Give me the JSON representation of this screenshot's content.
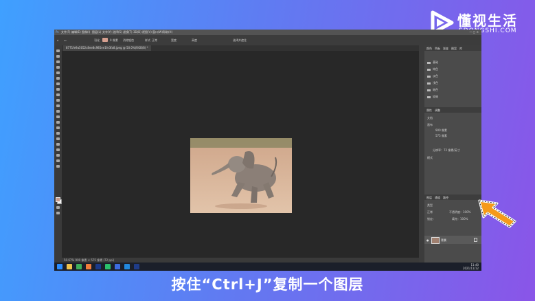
{
  "brand": {
    "name_cn": "懂视生活",
    "name_en": "SDONGSHI.COM"
  },
  "menu": [
    "文件(F)",
    "编辑(E)",
    "图像(I)",
    "图层(L)",
    "文字(Y)",
    "选择(S)",
    "滤镜(T)",
    "3D(D)",
    "视图(V)",
    "窗口(W)",
    "帮助(H)"
  ],
  "options_bar": {
    "feather_label": "羽化",
    "feather_value": "0 像素",
    "antialias": "消除锯齿",
    "style_label": "样式",
    "style_value": "正常",
    "width_label": "宽度",
    "height_label": "高度",
    "select_mask": "选择并遮住"
  },
  "document_tab": "8771fe9a5052c8ee8c985ee1fe3fa8.jpeg @ 50.0%(RGB/8) *",
  "status": "50.67%   900 像素 × 575 像素 (72 ppi)",
  "panels": {
    "top_tabs": [
      "颜色",
      "色板",
      "渐变",
      "图案",
      "库"
    ],
    "swatch_groups": [
      "基础",
      "纯色",
      "淡色",
      "浅色",
      "暗色",
      "较暗"
    ],
    "properties_tabs": [
      "属性",
      "调整"
    ],
    "properties_doc": "文档",
    "canvas_label": "画布",
    "width_value": "900 像素",
    "height_value": "575 像素",
    "resolution": "分辨率：72 像素/英寸",
    "mode": "模式",
    "layers_tabs": [
      "图层",
      "通道",
      "路径"
    ],
    "layer_kind": "类型",
    "blend_mode": "正常",
    "opacity": "不透明度：100%",
    "lock_label": "锁定：",
    "fill": "填充：100%",
    "layer_name": "背景"
  },
  "taskbar": {
    "time": "11:40",
    "date": "2021/11/12"
  },
  "caption": "按住“Ctrl+J”复制一个图层",
  "colors": {
    "accent_arrow": "#f59a1a",
    "panel_bg": "#4b4b4b",
    "canvas_bg": "#282828"
  }
}
